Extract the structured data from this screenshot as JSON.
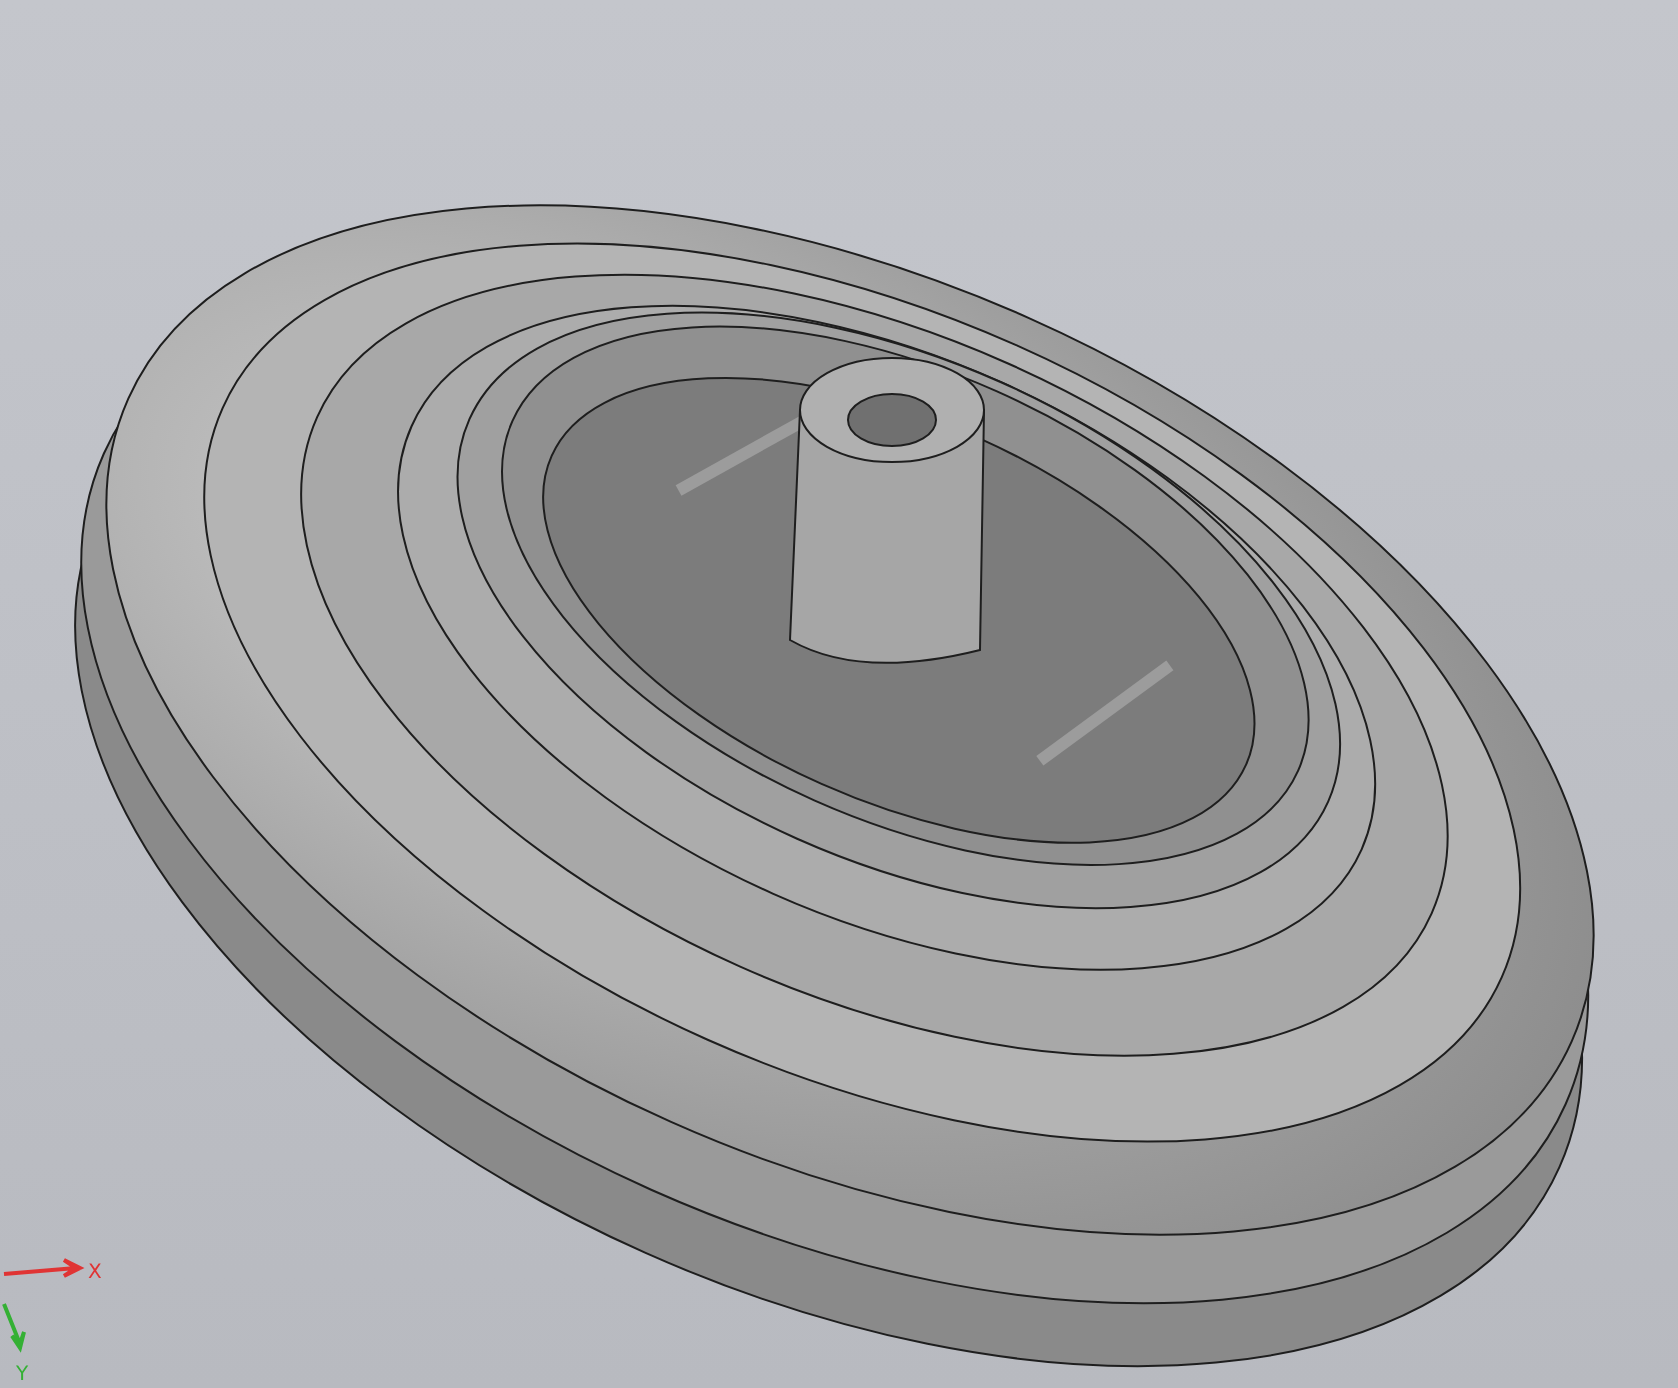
{
  "viewport": {
    "axes": [
      {
        "kind": "x",
        "label": "X",
        "color": "#e03434"
      },
      {
        "kind": "y",
        "label": "Y",
        "color": "#34b034"
      }
    ]
  }
}
